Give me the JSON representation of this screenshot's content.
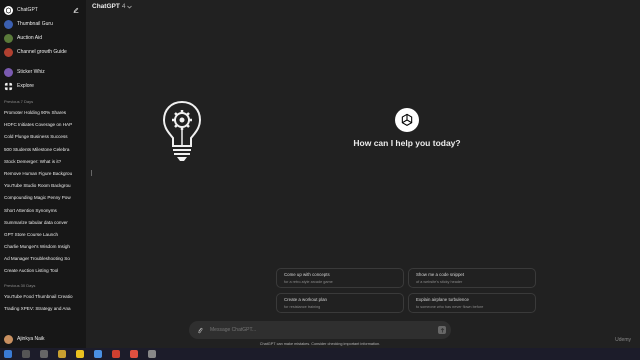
{
  "sidebar": {
    "top_items": [
      {
        "label": "ChatGPT",
        "icon": "openai-logo-icon"
      },
      {
        "label": "Thumbnail Guru",
        "color": "#3b5fb0"
      },
      {
        "label": "Auction Aid",
        "color": "#5a7a3a"
      },
      {
        "label": "Channel growth Guide",
        "color": "#b04030"
      },
      {
        "label": "Sticker Whiz",
        "color": "#7a5ab0"
      },
      {
        "label": "Explore",
        "icon": "grid-icon"
      }
    ],
    "section_recent": "Previous 7 Days",
    "history": [
      "Promoter Holding 90% Shares",
      "HDFC Initiates Coverage on HAP",
      "Cold Plunge Business Success",
      "500 Students Milestone Celebra",
      "Stock Demerger: What is it?",
      "Remove Human Figure Backgrou",
      "YouTube Studio Room Backgrou",
      "Compounding Magic Penny Pow",
      "Short Attention Synonyms",
      "Summarize tabular data conver",
      "GPT Store Course Launch",
      "Charlie Munger's Wisdom Insigh",
      "Ad Manager Troubleshooting So",
      "Create Auction Listing Tool"
    ],
    "section_older": "Previous 30 Days",
    "history_older": [
      "YouTube Food Thumbnail Creatio",
      "Trading XPEV: Strategy and Ana"
    ],
    "user_name": "Ajinkya Naik"
  },
  "header": {
    "model_label": "ChatGPT",
    "model_version": "4",
    "chevron": "chevron-down-icon"
  },
  "main": {
    "headline": "How can I help you today?",
    "suggestions": [
      {
        "title": "Come up with concepts",
        "subtitle": "for a retro-style arcade game"
      },
      {
        "title": "Show me a code snippet",
        "subtitle": "of a website's sticky header"
      },
      {
        "title": "Create a workout plan",
        "subtitle": "for resistance training"
      },
      {
        "title": "Explain airplane turbulence",
        "subtitle": "to someone who has never flown before"
      }
    ],
    "composer_placeholder": "Message ChatGPT...",
    "disclaimer": "ChatGPT can make mistakes. Consider checking important information.",
    "watermark": "Udemy"
  },
  "colors": {
    "sidebar_bg": "#171717",
    "main_bg": "#212121",
    "composer_bg": "#2f2f2f"
  }
}
